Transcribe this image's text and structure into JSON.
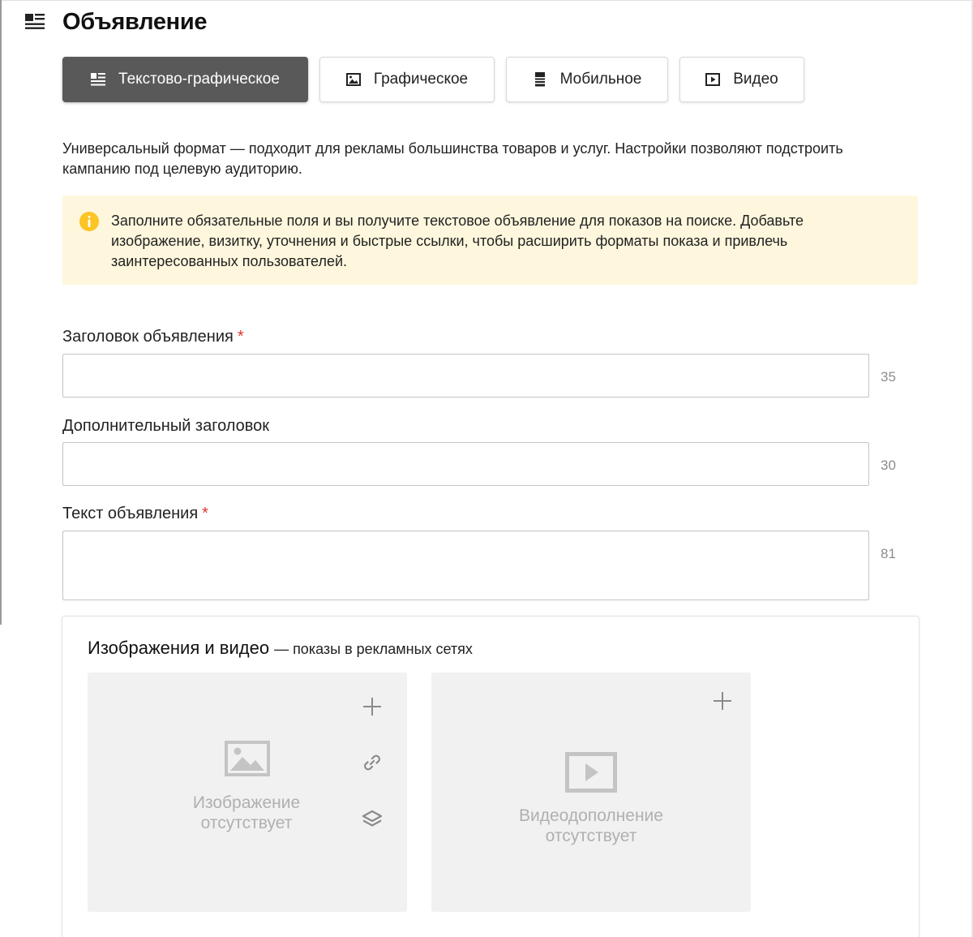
{
  "header": {
    "title": "Объявление",
    "icon": "text-graphic-icon"
  },
  "tabs": [
    {
      "label": "Текстово-графическое",
      "icon": "text-graphic-icon",
      "active": true
    },
    {
      "label": "Графическое",
      "icon": "image-icon",
      "active": false
    },
    {
      "label": "Мобильное",
      "icon": "mobile-icon",
      "active": false
    },
    {
      "label": "Видео",
      "icon": "video-icon",
      "active": false
    }
  ],
  "description": "Универсальный формат — подходит для рекламы большинства товаров и услуг. Настройки позволяют подстроить кампанию под целевую аудиторию.",
  "notice": {
    "text": "Заполните обязательные поля и вы получите текстовое объявление для показов на поиске. Добавьте изображение, визитку, уточнения и быстрые ссылки, чтобы расширить форматы показа и привлечь заинтересованных пользователей.",
    "icon": "info-icon",
    "color": "#fef7dd"
  },
  "fields": {
    "title": {
      "label": "Заголовок объявления",
      "required_mark": "*",
      "value": "",
      "counter": "35"
    },
    "extra_title": {
      "label": "Дополнительный заголовок",
      "value": "",
      "counter": "30"
    },
    "text": {
      "label": "Текст объявления",
      "required_mark": "*",
      "value": "",
      "counter": "81"
    }
  },
  "media": {
    "title": "Изображения и видео",
    "subtitle": "— показы в рекламных сетях",
    "image_card": {
      "caption_line1": "Изображение",
      "caption_line2": "отсутствует"
    },
    "video_card": {
      "caption_line1": "Видеодополнение",
      "caption_line2": "отсутствует"
    }
  },
  "colors": {
    "active_tab": "#595959",
    "required": "#e0342c",
    "notice_icon": "#fcc424"
  }
}
